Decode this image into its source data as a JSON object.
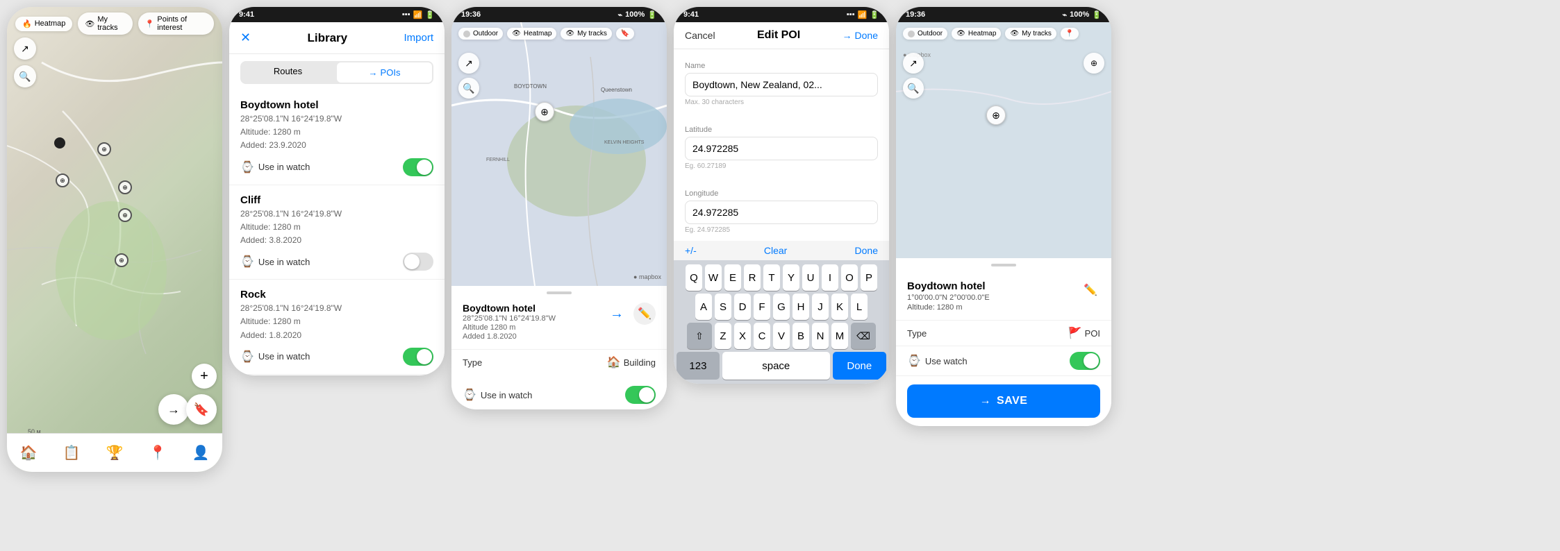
{
  "screen1": {
    "toolbar": {
      "heatmap": "Heatmap",
      "my_tracks": "My tracks",
      "points_of_interest": "Points of interest"
    },
    "tabs": [
      "home",
      "list",
      "trophy",
      "location-pin",
      "person"
    ],
    "zoom_plus": "+"
  },
  "screen2": {
    "status_time": "9:41",
    "header": {
      "close_label": "✕",
      "title": "Library",
      "import_label": "Import"
    },
    "tabs": {
      "routes": "Routes",
      "pois": "POIs",
      "arrow": "→"
    },
    "pois": [
      {
        "name": "Boydtown hotel",
        "coords": "28°25'08.1\"N 16°24'19.8\"W",
        "altitude": "Altitude: 1280 m",
        "added": "Added: 23.9.2020",
        "use_watch": "Use in watch",
        "toggle": "on"
      },
      {
        "name": "Cliff",
        "coords": "28°25'08.1\"N 16°24'19.8\"W",
        "altitude": "Altitude: 1280 m",
        "added": "Added: 3.8.2020",
        "use_watch": "Use in watch",
        "toggle": "off"
      },
      {
        "name": "Rock",
        "coords": "28°25'08.1\"N 16°24'19.8\"W",
        "altitude": "Altitude: 1280 m",
        "added": "Added: 1.8.2020",
        "use_watch": "Use in watch",
        "toggle": "on"
      }
    ]
  },
  "screen3": {
    "status_time": "19:36",
    "status_battery": "100%",
    "toolbar": {
      "outdoor": "Outdoor",
      "heatmap": "Heatmap",
      "my_tracks": "My tracks"
    },
    "poi": {
      "name": "Boydtown hotel",
      "coords": "28°25'08.1\"N 16°24'19.8\"W",
      "altitude": "Altitude 1280 m",
      "added": "Added 1.8.2020",
      "type_label": "Type",
      "type_value": "Building",
      "use_watch": "Use in watch",
      "toggle": "on"
    }
  },
  "screen4": {
    "status_time": "9:41",
    "header": {
      "cancel": "Cancel",
      "title": "Edit POI",
      "arrow": "→",
      "done": "Done"
    },
    "fields": {
      "name_label": "Name",
      "name_value": "Boydtown, New Zealand, 02...",
      "name_hint": "Max. 30 characters",
      "lat_label": "Latitude",
      "lat_value": "24.972285",
      "lat_hint": "Eg. 60.27189",
      "lon_label": "Longitude",
      "lon_value": "24.972285",
      "lon_hint": "Eg. 24.972285"
    },
    "keyboard": {
      "rows": [
        [
          "Q",
          "W",
          "E",
          "R",
          "T",
          "Y",
          "U",
          "I",
          "O",
          "P"
        ],
        [
          "A",
          "S",
          "D",
          "F",
          "G",
          "H",
          "J",
          "K",
          "L"
        ],
        [
          "Z",
          "X",
          "C",
          "V",
          "B",
          "N",
          "M"
        ]
      ],
      "num_label": "123",
      "space_label": "space",
      "done_label": "Done",
      "plus_minus": "+/-",
      "clear": "Clear",
      "kbd_done": "Done"
    }
  },
  "screen5": {
    "status_time": "19:36",
    "status_battery": "100%",
    "toolbar": {
      "outdoor": "Outdoor",
      "heatmap": "Heatmap",
      "my_tracks": "My tracks"
    },
    "poi": {
      "name": "Boydtown hotel",
      "coords": "1°00'00.0\"N 2°00'00.0\"E",
      "altitude": "Altitude: 1280 m",
      "type_label": "Type",
      "type_value": "POI",
      "use_watch": "Use watch",
      "toggle": "on",
      "save_label": "SAVE"
    }
  }
}
